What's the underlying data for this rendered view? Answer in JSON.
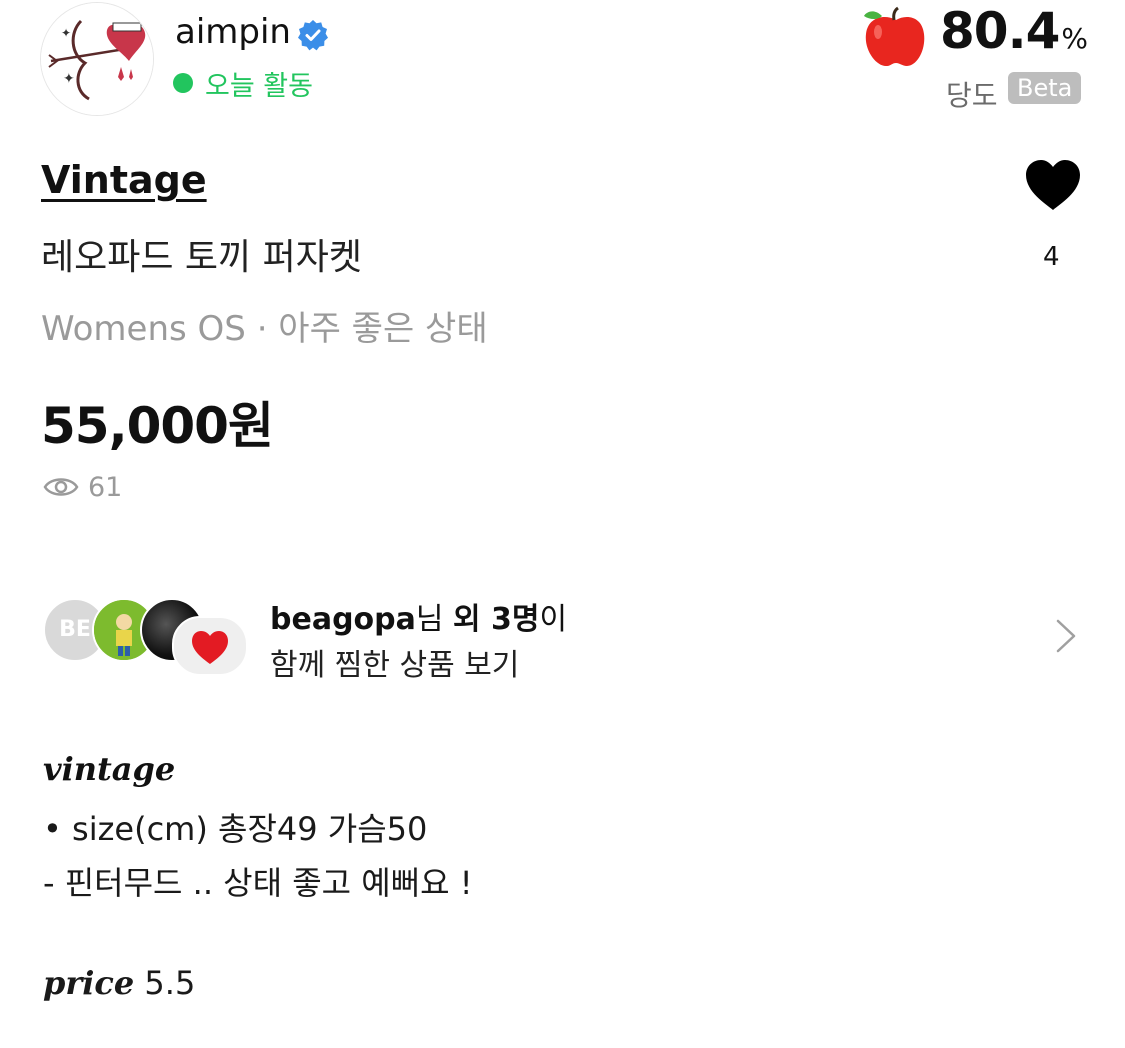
{
  "seller": {
    "name": "aimpin",
    "status": "오늘 활동",
    "sweetness": {
      "value": "80.4",
      "unit": "%",
      "label": "당도",
      "badge": "Beta"
    }
  },
  "product": {
    "brand": "Vintage",
    "title": "레오파드 토끼 퍼자켓",
    "meta": "Womens OS · 아주 좋은 상태",
    "price": "55,000원",
    "views": "61",
    "likes": "4"
  },
  "liked_together": {
    "avatar_initials": "BE",
    "user": "beagopa",
    "suffix_nim": "님 ",
    "others": "외 3명",
    "suffix_i": "이",
    "cta": "함께 찜한 상품 보기"
  },
  "description": {
    "brand": "vintage",
    "line1": "• size(cm) 총장49 가슴50",
    "line2": "- 핀터무드 .. 상태 좋고 예뻐요 !",
    "price_label": "price",
    "price_value": " 5.5"
  },
  "colors": {
    "online": "#22c55e",
    "verified": "#3b8ee8",
    "apple": "#e53935",
    "muted": "#9a9a9a"
  },
  "icons": [
    "verified-badge-icon",
    "apple-icon",
    "heart-icon",
    "eye-icon",
    "chevron-right-icon",
    "heart-emoji-icon"
  ]
}
